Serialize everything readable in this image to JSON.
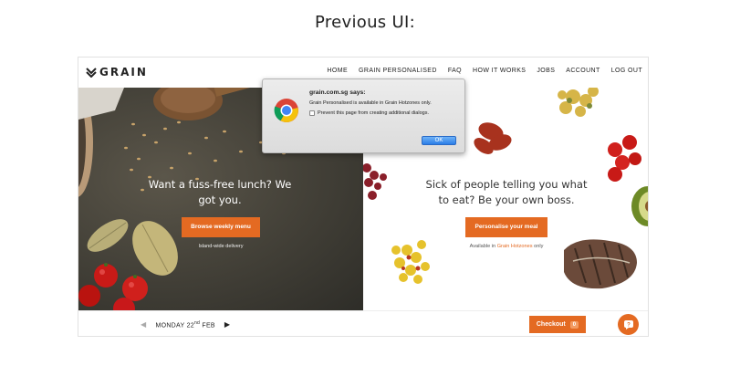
{
  "caption": "Previous UI:",
  "nav": {
    "logo": "GRAIN",
    "items": [
      "HOME",
      "GRAIN PERSONALISED",
      "FAQ",
      "HOW IT WORKS",
      "JOBS",
      "ACCOUNT",
      "LOG OUT"
    ]
  },
  "hero_left": {
    "title": "Want a fuss-free lunch? We got you.",
    "button": "Browse weekly menu",
    "subtext": "Island-wide delivery"
  },
  "hero_right": {
    "title": "Sick of people telling you what to eat? Be your own boss.",
    "button": "Personalise your meal",
    "subtext_prefix": "Available in",
    "subtext_highlight": "Grain Hotzones",
    "subtext_suffix": "only"
  },
  "dialog": {
    "icon": "chrome-icon",
    "title": "grain.com.sg says:",
    "message": "Grain Personalised is available in Grain Hotzones only.",
    "checkbox_label": "Prevent this page from creating additional dialogs.",
    "ok_label": "OK"
  },
  "bottom_bar": {
    "day": "MONDAY 22",
    "day_suffix": "nd",
    "month": "FEB",
    "checkout_label": "Checkout",
    "checkout_count": "0",
    "help_icon": "chat-help-icon"
  },
  "colors": {
    "accent": "#e46a22",
    "dark_bg": "#46433a"
  }
}
